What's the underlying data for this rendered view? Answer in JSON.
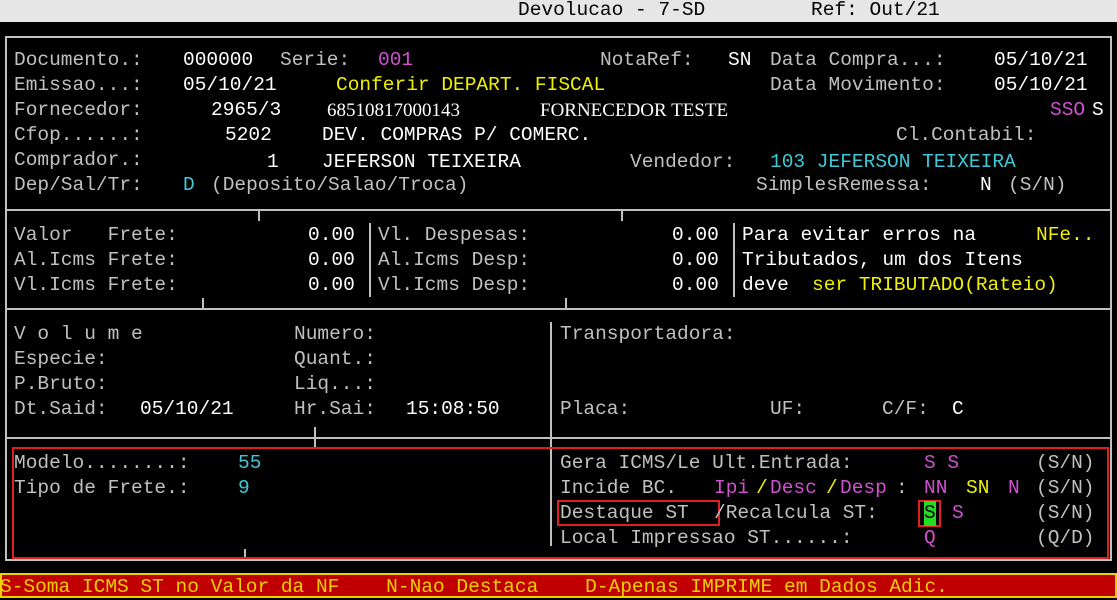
{
  "titlebar": {
    "title": "Devolucao - 7-SD",
    "ref": "Ref: Out/21"
  },
  "header": {
    "documento_label": "Documento.:",
    "documento_value": "000000",
    "serie_label": "Serie:",
    "serie_value": "001",
    "notaref_label": "NotaRef:",
    "notaref_value": "SN",
    "data_compra_label": "Data Compra...:",
    "data_compra_value": "05/10/21",
    "emissao_label": "Emissao...:",
    "emissao_value": "05/10/21",
    "conferir_text": "Conferir DEPART. FISCAL",
    "data_mov_label": "Data Movimento:",
    "data_mov_value": "05/10/21",
    "fornecedor_label": "Fornecedor:",
    "fornecedor_code": "2965/3",
    "fornecedor_cnpj": "68510817000143",
    "fornecedor_name": "FORNECEDOR TESTE",
    "ssos_a": "SSO",
    "ssos_b": "S",
    "cfop_label": "Cfop......:",
    "cfop_value": "5202",
    "cfop_desc": "DEV. COMPRAS P/ COMERC.",
    "cl_contabil_label": "Cl.Contabil:",
    "comprador_label": "Comprador.:",
    "comprador_code": "1",
    "comprador_name": "JEFERSON TEIXEIRA",
    "vendedor_label": "Vendedor:",
    "vendedor_value": "103 JEFERSON TEIXEIRA",
    "dep_label": "Dep/Sal/Tr:",
    "dep_value": "D",
    "dep_desc": "(Deposito/Salao/Troca)",
    "simples_label": "SimplesRemessa:",
    "simples_value": "N",
    "simples_hint": "(S/N)"
  },
  "frete": {
    "valor_frete_label": "Valor   Frete:",
    "valor_frete_value": "0.00",
    "al_icms_frete_label": "Al.Icms Frete:",
    "al_icms_frete_value": "0.00",
    "vl_icms_frete_label": "Vl.Icms Frete:",
    "vl_icms_frete_value": "0.00",
    "vl_despesas_label": "Vl. Despesas:",
    "vl_despesas_value": "0.00",
    "al_icms_desp_label": "Al.Icms Desp:",
    "al_icms_desp_value": "0.00",
    "vl_icms_desp_label": "Vl.Icms Desp:",
    "vl_icms_desp_value": "0.00",
    "note_1a": "Para evitar erros na ",
    "note_1b": "NFe..",
    "note_2": "Tributados, um dos Itens",
    "note_3a": "deve ",
    "note_3b": "ser TRIBUTADO(Rateio)"
  },
  "volume": {
    "volume_label": "V o l u m e",
    "especie_label": "Especie:",
    "pbruto_label": "P.Bruto:",
    "dtsaid_label": "Dt.Said:",
    "dtsaid_value": "05/10/21",
    "numero_label": "Numero:",
    "quant_label": "Quant.:",
    "liq_label": "Liq...:",
    "hrsai_label": "Hr.Sai:",
    "hrsai_value": "15:08:50",
    "transportadora_label": "Transportadora:",
    "placa_label": "Placa:",
    "uf_label": "UF:",
    "cf_label": "C/F:",
    "cf_value": "C"
  },
  "nfe": {
    "modelo_label": "Modelo........:",
    "modelo_value": "55",
    "tipo_frete_label": "Tipo de Frete.:",
    "tipo_frete_value": "9",
    "gera_icms_label": "Gera ICMS/Le Ult.Entrada:",
    "gera_icms_value": "S S",
    "gera_icms_hint": "(S/N)",
    "incide_bc_label": "Incide BC.",
    "incide_ipi": "Ipi",
    "incide_desc": "Desc",
    "incide_desp": "Desp",
    "slash": "/",
    "colon": ":",
    "incide_v1": "NN",
    "incide_v2": "SN",
    "incide_v3": "N",
    "incide_hint": "(S/N)",
    "destaque_label": "Destaque ST",
    "recalcula_label": "/Recalcula ST:",
    "destaque_value": "S",
    "recalcula_value": "S",
    "destaque_hint": "(S/N)",
    "local_label": "Local Impressao ST......:",
    "local_value": "Q",
    "local_hint": "(Q/D)"
  },
  "status": {
    "text": "S-Soma ICMS ST no Valor da NF    N-Nao Destaca    D-Apenas IMPRIME em Dados Adic."
  },
  "colors": {
    "background": "#000000",
    "text": "#c0c0c0",
    "magenta": "#d050d0",
    "cyan": "#40c8d8",
    "yellow": "#f0f000",
    "statusbar": "#c00000",
    "highlight": "#22dd22",
    "redbox": "#e02020"
  }
}
